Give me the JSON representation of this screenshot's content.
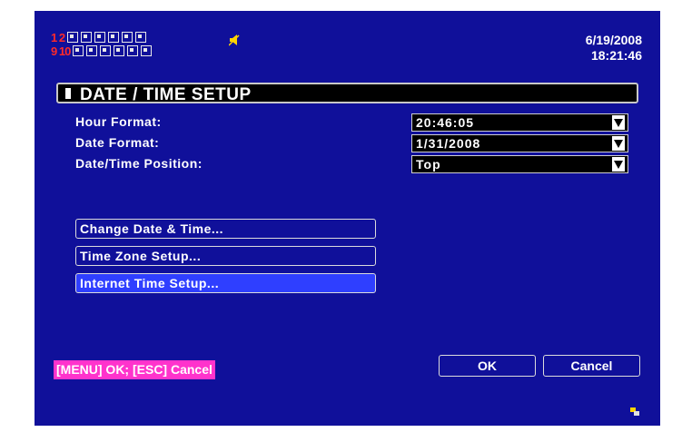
{
  "status_bar": {
    "row1_numbers": "1 2",
    "row2_numbers": "9 10",
    "date": "6/19/2008",
    "time": "18:21:46",
    "alert_icon": "speaker-alert-icon",
    "colors": {
      "channel_numbers": "#ff2a2a",
      "alert": "#ffd400"
    }
  },
  "dialog": {
    "title": "DATE / TIME SETUP",
    "fields": [
      {
        "label": "Hour Format:",
        "value": "20:46:05"
      },
      {
        "label": "Date Format:",
        "value": "1/31/2008"
      },
      {
        "label": "Date/Time Position:",
        "value": "Top"
      }
    ],
    "menu_buttons": [
      {
        "label": "Change Date & Time..."
      },
      {
        "label": "Time Zone Setup..."
      },
      {
        "label": "Internet Time Setup..."
      }
    ],
    "hint": "[MENU] OK; [ESC] Cancel",
    "ok_label": "OK",
    "cancel_label": "Cancel",
    "colors": {
      "background": "#10109a",
      "selected": "#2f3fff",
      "hint_bg": "#ff33cc"
    }
  }
}
